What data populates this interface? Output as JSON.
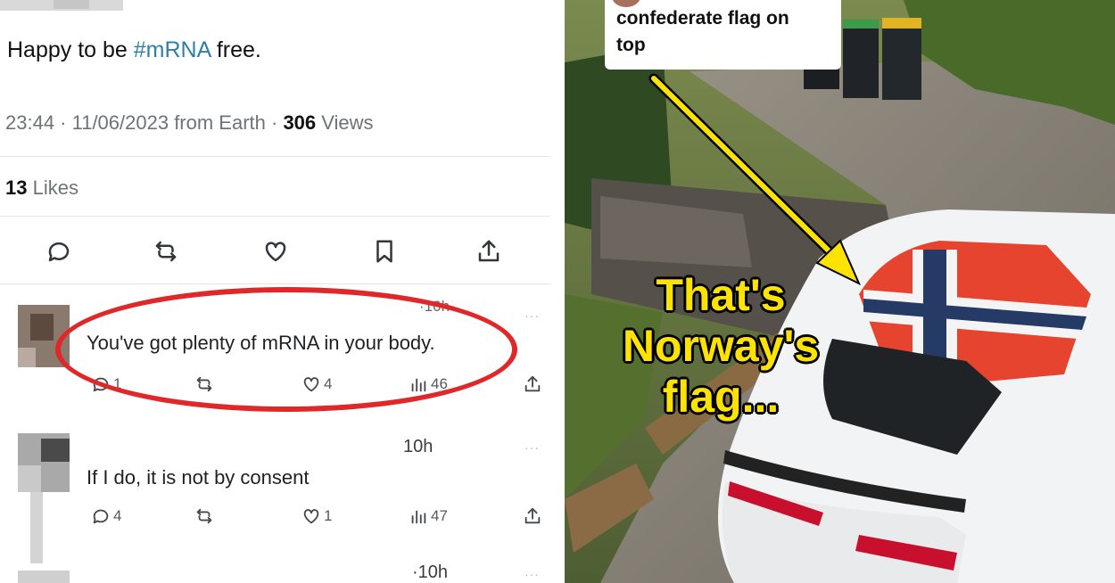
{
  "tweet": {
    "text_prefix": "Happy to be ",
    "hashtag": "#mRNA",
    "text_suffix": " free.",
    "meta_prefix": "23:44 · 11/06/2023 from Earth · ",
    "views_count": "306",
    "views_label": " Views",
    "likes_count": "13",
    "likes_label": " Likes",
    "actions": [
      "reply-icon",
      "retweet-icon",
      "heart-icon",
      "bookmark-icon",
      "share-icon"
    ]
  },
  "replies": [
    {
      "time": "·10h",
      "text": "You've got plenty of mRNA in your body.",
      "replies": "1",
      "likes": "4",
      "views": "46",
      "highlighted": true
    },
    {
      "time": "10h",
      "text": "If I do, it is not by consent",
      "replies": "4",
      "likes": "1",
      "views": "47",
      "highlighted": false
    },
    {
      "time": "·10h",
      "text": "",
      "replies": "",
      "likes": "",
      "views": "",
      "highlighted": false
    }
  ],
  "more_label": "···",
  "photo": {
    "caption_line1": "confederate flag on",
    "caption_line2": "top",
    "overlay_line1": "That's",
    "overlay_line2": "Norway's",
    "overlay_line3": "flag..."
  },
  "colors": {
    "highlight_ellipse": "#e0282a",
    "hashtag": "#2f7fa6",
    "overlay_text": "#ffe300",
    "arrow": "#ffe300"
  }
}
